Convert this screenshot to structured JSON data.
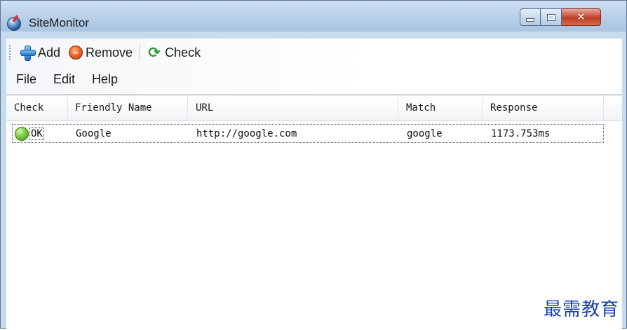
{
  "window": {
    "title": "SiteMonitor",
    "close_glyph": "✕"
  },
  "toolbar": {
    "add_label": "Add",
    "remove_label": "Remove",
    "check_label": "Check"
  },
  "menu": {
    "items": [
      "File",
      "Edit",
      "Help"
    ]
  },
  "table": {
    "columns": [
      "Check",
      "Friendly Name",
      "URL",
      "Match",
      "Response"
    ],
    "rows": [
      {
        "status": "OK",
        "status_color": "#6fbe3a",
        "name": "Google",
        "url": "http://google.com",
        "match": "google",
        "response": "1173.753ms"
      }
    ]
  },
  "watermark": {
    "text": "最需教育"
  },
  "colors": {
    "title_bar": "#b8cfe7",
    "close_button": "#c74731",
    "watermark": "#1a40a8"
  },
  "icons": {
    "app": "globe-icon",
    "add": "plus-icon",
    "remove": "remove-icon",
    "check": "refresh-icon",
    "status": "green-status-icon"
  }
}
